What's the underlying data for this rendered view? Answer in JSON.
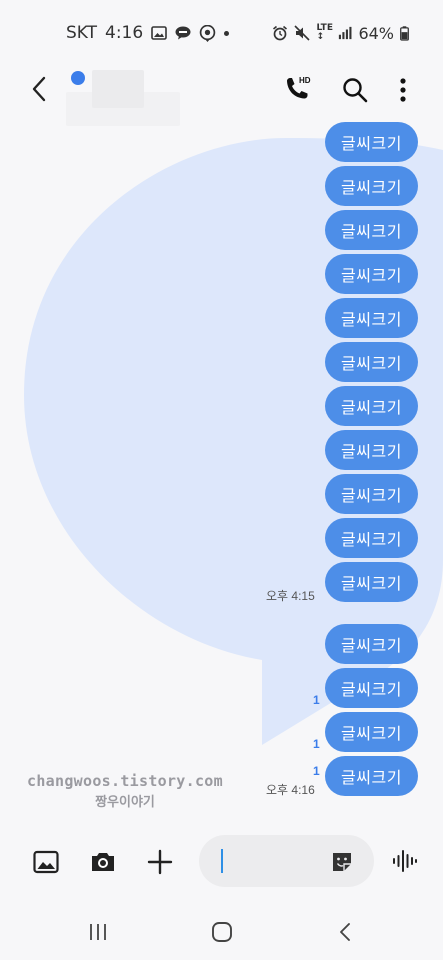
{
  "status_bar": {
    "carrier": "SKT",
    "time": "4:16",
    "network": "LTE",
    "battery": "64%",
    "icons": [
      "image-icon",
      "talk-icon",
      "location-icon",
      "dot-icon",
      "alarm-icon",
      "mute-icon",
      "lte-icon",
      "signal-icon",
      "battery-icon"
    ]
  },
  "header": {
    "icons": [
      "back-icon",
      "hd-call-icon",
      "search-icon",
      "more-icon"
    ],
    "call_badge": "HD",
    "online_color": "#3b7dea"
  },
  "messages": {
    "bubble_color": "#4d8ee8",
    "group1": [
      "글씨크기",
      "글씨크기",
      "글씨크기",
      "글씨크기",
      "글씨크기",
      "글씨크기",
      "글씨크기",
      "글씨크기",
      "글씨크기",
      "글씨크기",
      "글씨크기"
    ],
    "group1_time": "오후 4:15",
    "group2": [
      "글씨크기",
      "글씨크기",
      "글씨크기",
      "글씨크기"
    ],
    "group2_time": "오후 4:16",
    "unread": [
      "1",
      "1",
      "1"
    ]
  },
  "credit": {
    "url": "changwoos.tistory.com",
    "name": "짱우이야기"
  },
  "composer": {
    "icons": [
      "gallery-icon",
      "camera-icon",
      "plus-icon",
      "sticker-icon",
      "voice-icon"
    ],
    "input_value": "",
    "accent": "#2e8fe6"
  },
  "nav": {
    "icons": [
      "recents-icon",
      "home-icon",
      "back-nav-icon"
    ]
  }
}
